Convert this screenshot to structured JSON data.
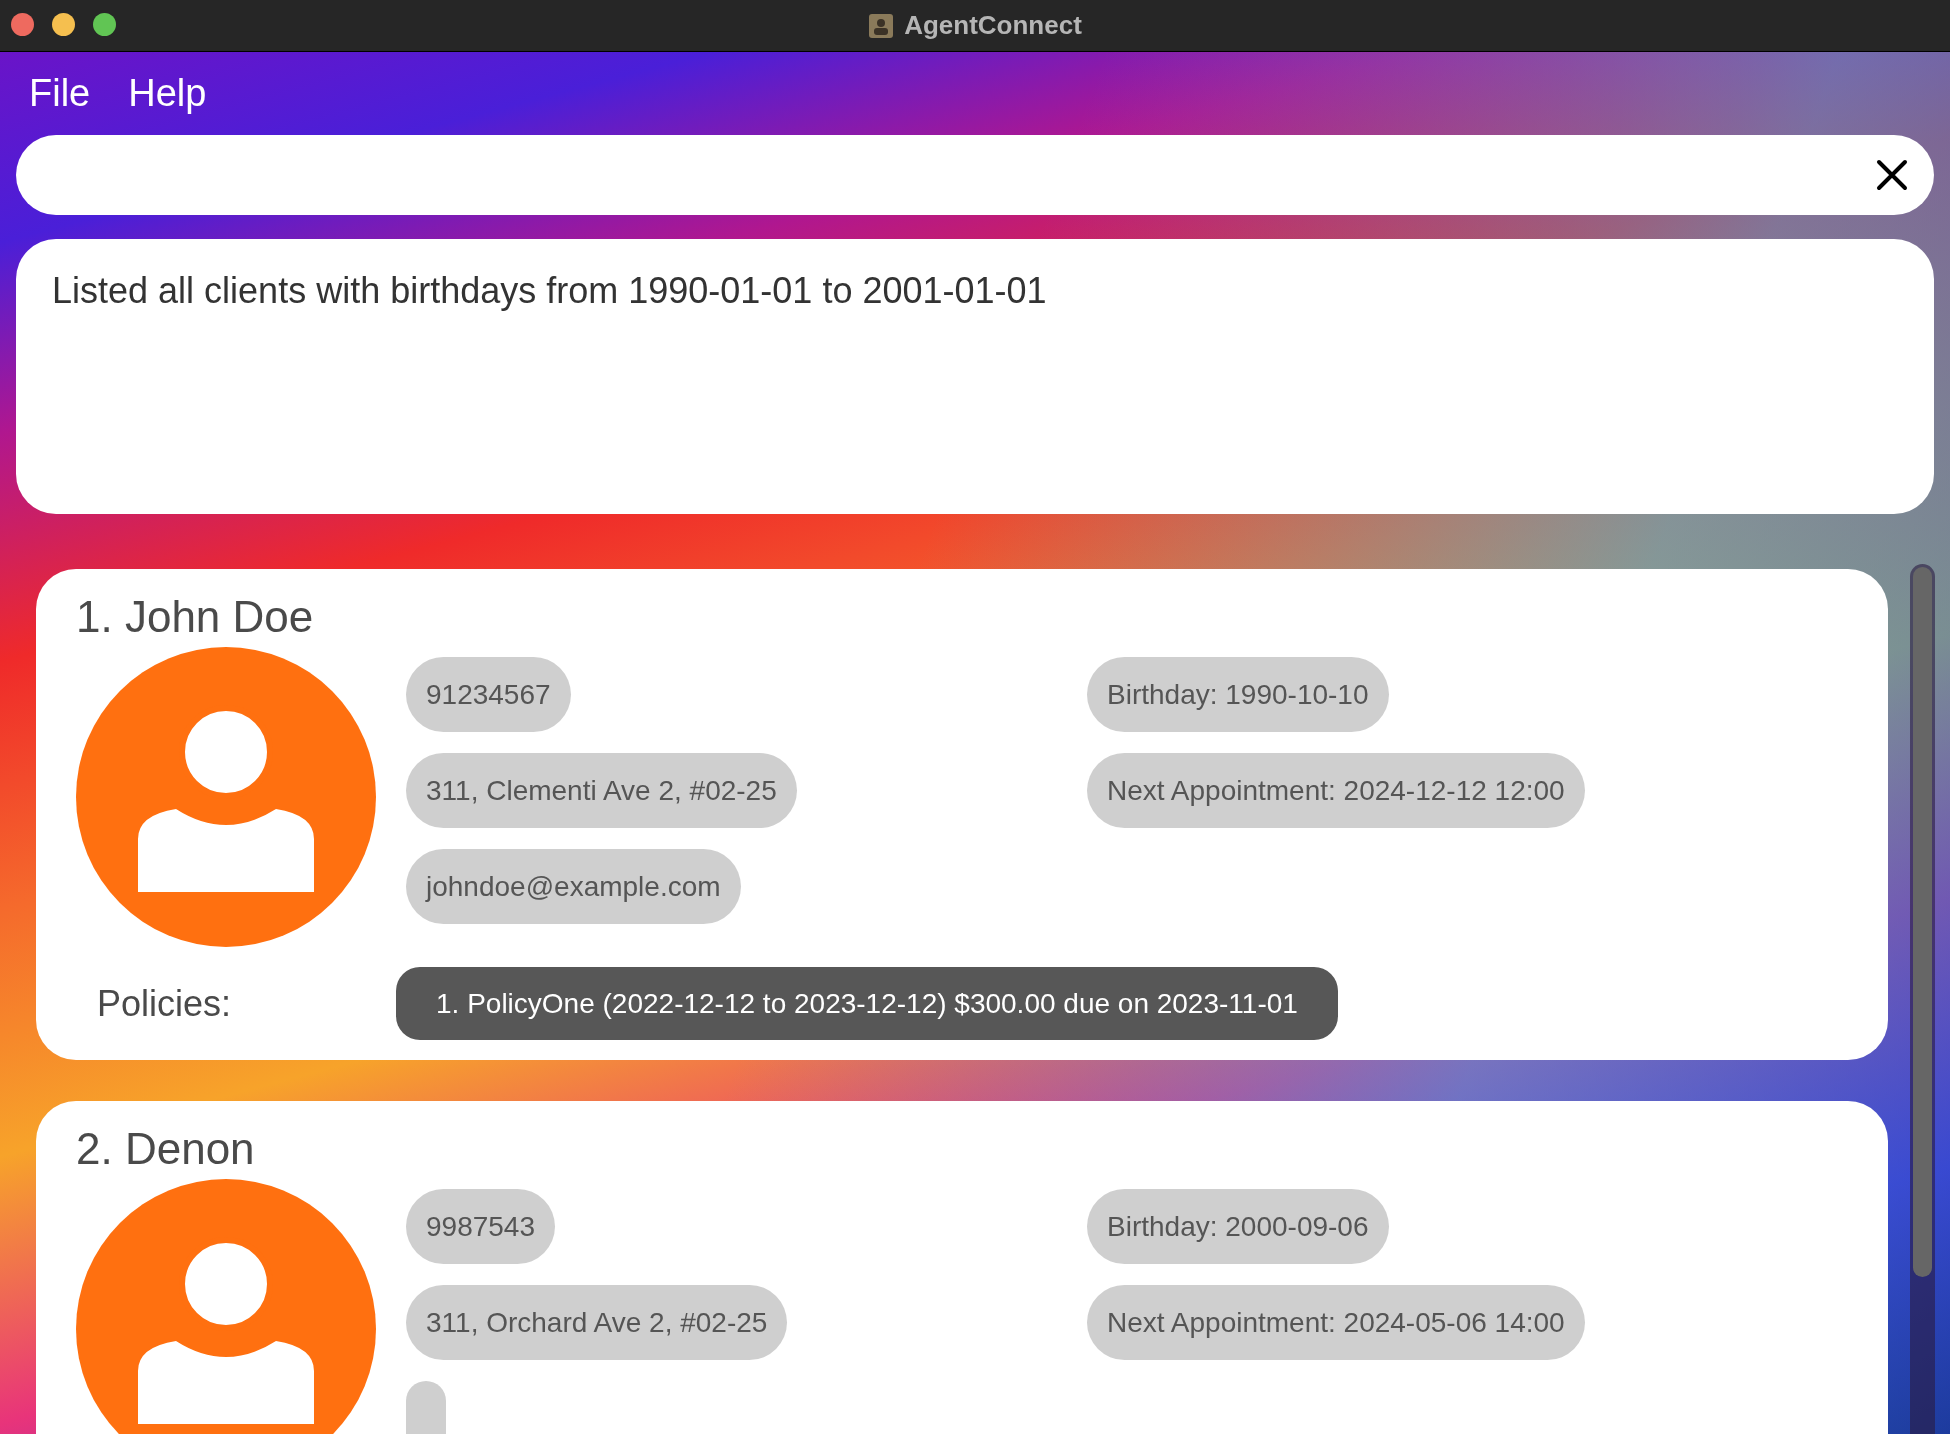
{
  "window": {
    "title": "AgentConnect"
  },
  "menu": [
    "File",
    "Help"
  ],
  "result": "Listed all clients with birthdays from 1990-01-01 to 2001-01-01",
  "clients": [
    {
      "name": "1. John Doe",
      "phone": "91234567",
      "birthday": "Birthday: 1990-10-10",
      "address": "311, Clementi Ave 2, #02-25",
      "appointment": "Next Appointment: 2024-12-12 12:00",
      "email": "johndoe@example.com",
      "policies_label": "Policies:",
      "policies": [
        "1. PolicyOne (2022-12-12 to 2023-12-12) $300.00 due on 2023-11-01"
      ]
    },
    {
      "name": "2. Denon",
      "phone": "9987543",
      "birthday": "Birthday: 2000-09-06",
      "address": "311, Orchard Ave 2, #02-25",
      "appointment": "Next Appointment: 2024-05-06 14:00"
    }
  ]
}
